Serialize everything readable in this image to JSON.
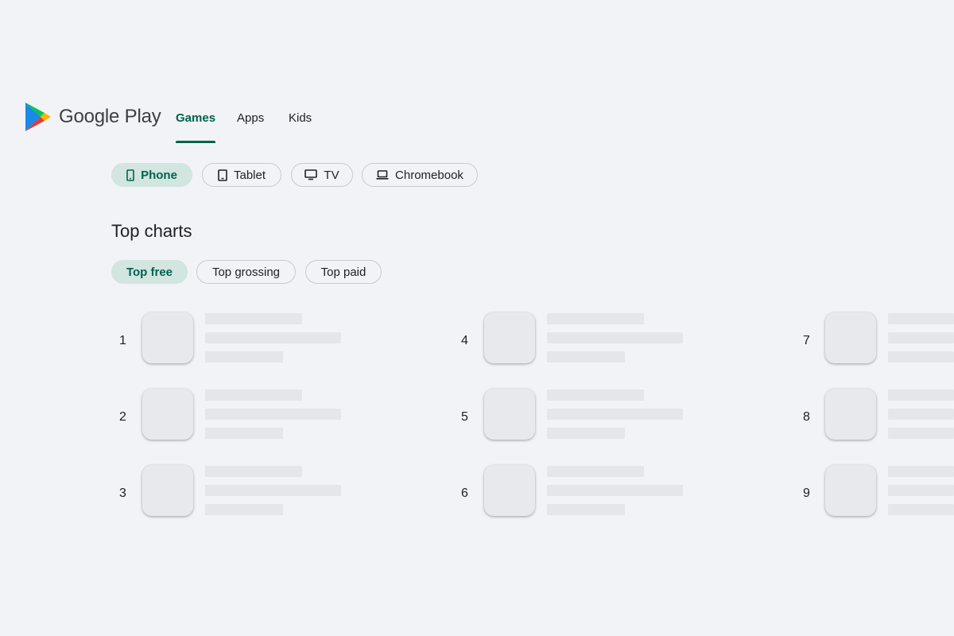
{
  "brand": {
    "name": "Google Play",
    "icon": "play-logo-icon"
  },
  "nav": {
    "items": [
      {
        "label": "Games",
        "active": true
      },
      {
        "label": "Apps",
        "active": false
      },
      {
        "label": "Kids",
        "active": false
      }
    ]
  },
  "device_filters": [
    {
      "label": "Phone",
      "icon": "phone-icon",
      "selected": true
    },
    {
      "label": "Tablet",
      "icon": "tablet-icon",
      "selected": false
    },
    {
      "label": "TV",
      "icon": "tv-icon",
      "selected": false
    },
    {
      "label": "Chromebook",
      "icon": "laptop-icon",
      "selected": false
    }
  ],
  "top_charts": {
    "title": "Top charts",
    "tabs": [
      {
        "label": "Top free",
        "selected": true
      },
      {
        "label": "Top grossing",
        "selected": false
      },
      {
        "label": "Top paid",
        "selected": false
      }
    ],
    "ranks": [
      "1",
      "2",
      "3",
      "4",
      "5",
      "6",
      "7",
      "8",
      "9"
    ]
  },
  "colors": {
    "accent": "#01634b",
    "chip_selected_bg": "#d2e5e0",
    "background": "#f1f3f6",
    "skeleton": "#e5e6ea"
  }
}
